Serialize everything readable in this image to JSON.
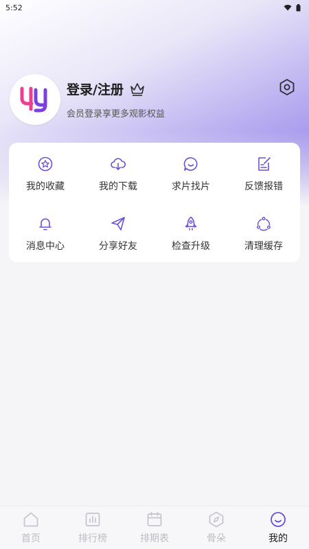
{
  "status_bar": {
    "time": "5:52"
  },
  "profile": {
    "login_label": "登录/注册",
    "subtitle": "会员登录享更多观影权益"
  },
  "grid": [
    {
      "label": "我的收藏",
      "icon": "star-circle-icon"
    },
    {
      "label": "我的下载",
      "icon": "cloud-download-icon"
    },
    {
      "label": "求片找片",
      "icon": "chat-smile-icon"
    },
    {
      "label": "反馈报错",
      "icon": "edit-note-icon"
    },
    {
      "label": "消息中心",
      "icon": "bell-icon"
    },
    {
      "label": "分享好友",
      "icon": "paper-plane-icon"
    },
    {
      "label": "检查升级",
      "icon": "rocket-icon"
    },
    {
      "label": "清理缓存",
      "icon": "recycle-icon"
    }
  ],
  "tabs": [
    {
      "label": "首页",
      "icon": "home-icon"
    },
    {
      "label": "排行榜",
      "icon": "ranking-icon"
    },
    {
      "label": "排期表",
      "icon": "calendar-icon"
    },
    {
      "label": "骨朵",
      "icon": "compass-icon"
    },
    {
      "label": "我的",
      "icon": "smile-face-icon",
      "active": true
    }
  ],
  "colors": {
    "accent": "#6a4fe0",
    "logo_pink": "#ec3f8f",
    "logo_purple": "#7b3fe4",
    "tab_inactive": "#bdbdc4",
    "tab_active_icon": "#6a4fe0"
  }
}
